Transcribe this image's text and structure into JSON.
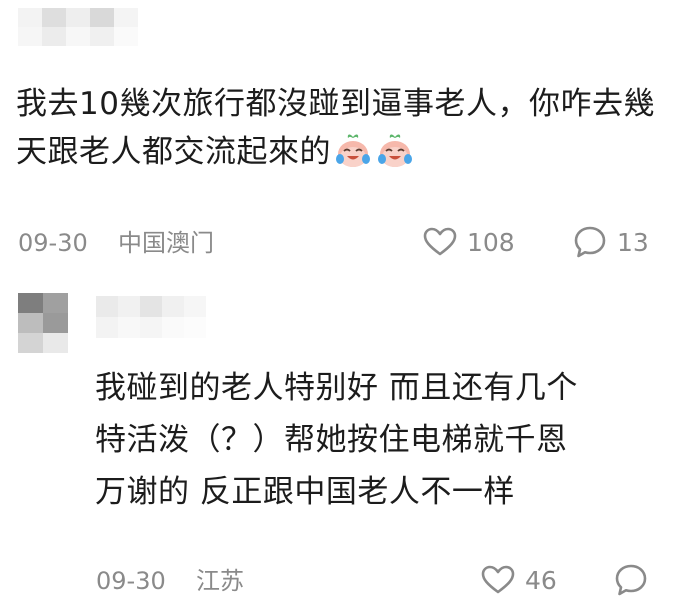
{
  "comments": [
    {
      "text": "我去10幾次旅行都沒踫到逼事老人，你咋去幾天跟老人都交流起來的",
      "emoji": [
        "crying-laughing-radish-emoji",
        "crying-laughing-radish-emoji"
      ],
      "date": "09-30",
      "location": "中国澳门",
      "likes": "108",
      "replies": "13"
    },
    {
      "text_lines": [
        "我碰到的老人特别好 而且还有几个",
        "特活泼（？）帮她按住电梯就千恩",
        "万谢的 反正跟中国老人不一样"
      ],
      "date": "09-30",
      "location": "江苏",
      "likes": "46"
    }
  ],
  "icons": {
    "like": "heart-outline-icon",
    "reply": "speech-bubble-icon"
  },
  "colors": {
    "text": "#1c1c1c",
    "meta": "#8a8a8a",
    "background": "#ffffff"
  }
}
